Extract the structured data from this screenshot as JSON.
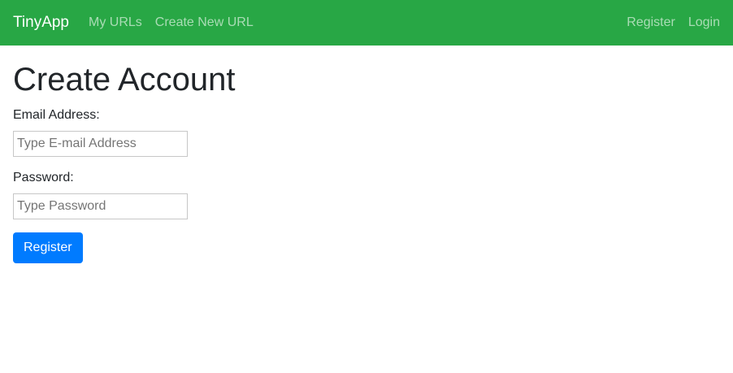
{
  "navbar": {
    "brand": "TinyApp",
    "left_links": [
      "My URLs",
      "Create New URL"
    ],
    "right_links": [
      "Register",
      "Login"
    ],
    "background_color": "#28a745"
  },
  "page": {
    "title": "Create Account"
  },
  "form": {
    "email_label": "Email Address:",
    "email_value": "",
    "email_placeholder": "Type E-mail Address",
    "password_label": "Password:",
    "password_value": "",
    "password_placeholder": "Type Password",
    "submit_label": "Register",
    "submit_color": "#007bff"
  }
}
